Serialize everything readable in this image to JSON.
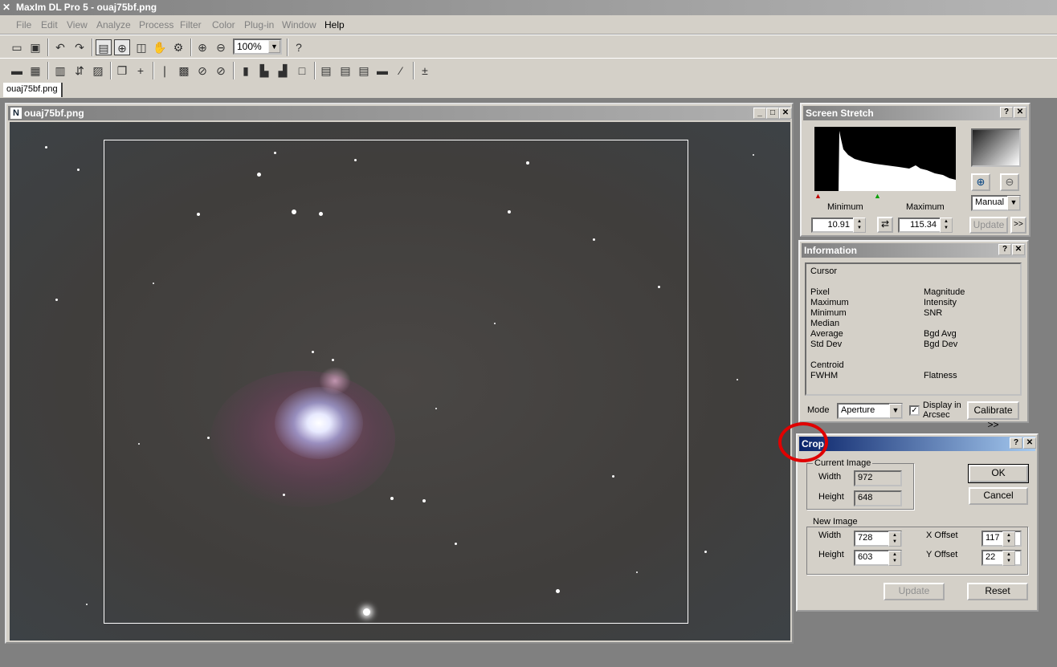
{
  "app": {
    "title": "MaxIm DL Pro 5 - ouaj75bf.png"
  },
  "menu": [
    "File",
    "Edit",
    "View",
    "Analyze",
    "Process",
    "Filter",
    "Color",
    "Plug-in",
    "Window",
    "Help"
  ],
  "toolbar": {
    "zoom": "100%"
  },
  "tabs": [
    "ouaj75bf.png"
  ],
  "image_window": {
    "title": "ouaj75bf.png"
  },
  "screen_stretch": {
    "title": "Screen Stretch",
    "min_label": "Minimum",
    "max_label": "Maximum",
    "min_value": "10.91",
    "max_value": "115.34",
    "mode": "Manual",
    "update_label": "Update",
    "more_label": ">>"
  },
  "information": {
    "title": "Information",
    "cursor_label": "Cursor",
    "left_labels": [
      "Pixel",
      "Maximum",
      "Minimum",
      "Median",
      "Average",
      "Std Dev",
      "",
      "Centroid",
      "FWHM"
    ],
    "right_labels": [
      "Magnitude",
      "Intensity",
      "SNR",
      "",
      "Bgd Avg",
      "Bgd Dev",
      "",
      "",
      "Flatness"
    ],
    "mode_label": "Mode",
    "mode_value": "Aperture",
    "display_arcsec": "Display in Arcsec",
    "display_arcsec_checked": true,
    "calibrate_label": "Calibrate >>"
  },
  "crop": {
    "title": "Crop",
    "current_group": "Current Image",
    "current_width_label": "Width",
    "current_width": "972",
    "current_height_label": "Height",
    "current_height": "648",
    "new_group": "New Image",
    "new_width_label": "Width",
    "new_width": "728",
    "new_height_label": "Height",
    "new_height": "603",
    "x_offset_label": "X Offset",
    "x_offset": "117",
    "y_offset_label": "Y Offset",
    "y_offset": "22",
    "ok_label": "OK",
    "cancel_label": "Cancel",
    "update_label": "Update",
    "reset_label": "Reset"
  },
  "colors": {
    "annotation": "#e00000",
    "active_title": "#0a246a"
  }
}
